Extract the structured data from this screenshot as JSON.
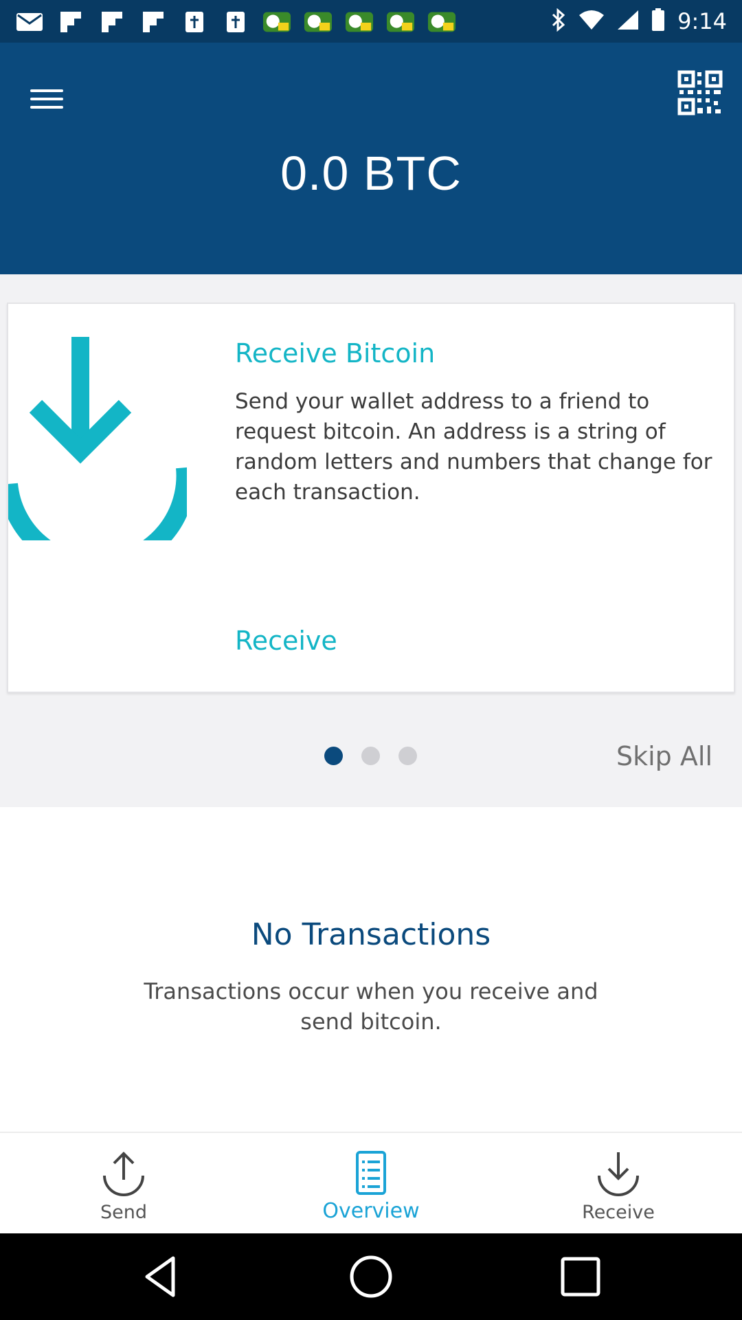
{
  "status_bar": {
    "time": "9:14",
    "icons": [
      "mail-icon",
      "flipboard-icon",
      "flipboard-icon",
      "flipboard-icon",
      "bible-icon",
      "bible-icon",
      "soccer-icon",
      "soccer-icon",
      "soccer-icon",
      "soccer-icon",
      "soccer-icon",
      "bluetooth-icon",
      "wifi-icon",
      "signal-icon",
      "battery-icon"
    ]
  },
  "header": {
    "balance": "0.0 BTC",
    "menu_icon": "hamburger-menu-icon",
    "qr_icon": "qr-code-icon"
  },
  "card": {
    "title": "Receive Bitcoin",
    "description": "Send your wallet address to a friend to request bitcoin. An address is a string of random letters and numbers that change for each transaction.",
    "action": "Receive",
    "accent": "#13b5c6"
  },
  "pager": {
    "pages": 3,
    "active": 1,
    "skip_label": "Skip All"
  },
  "empty_state": {
    "title": "No Transactions",
    "message": "Transactions occur when you receive and send bitcoin."
  },
  "bottom_nav": {
    "items": [
      {
        "label": "Send",
        "icon": "upload-arrow-icon"
      },
      {
        "label": "Overview",
        "icon": "list-document-icon"
      },
      {
        "label": "Receive",
        "icon": "download-arrow-icon"
      }
    ],
    "active_index": 1
  },
  "colors": {
    "header": "#0b4a7d",
    "status_bar": "#083a63",
    "accent": "#13b5c6",
    "active_nav": "#1aa3d6"
  }
}
